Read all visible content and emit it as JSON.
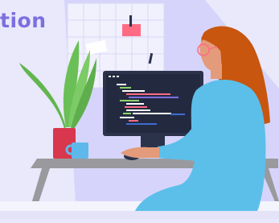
{
  "headline": {
    "text": "tion",
    "color": "#7d6fe0"
  },
  "colors": {
    "background": "#e9e9fb",
    "backdrop": "#d6d4fa",
    "whiteboard": "#f1f0fd",
    "board_line": "#d9d7f8",
    "sticky_note": "#ff6b83",
    "leaves": "#6bbf57",
    "plant_pot": "#d8374e",
    "mug": "#5fb8ea",
    "desk": "#9a9a9e",
    "monitor": "#2b334b",
    "shirt": "#5bbfea",
    "hair": "#c8560f",
    "skin": "#e39b7b",
    "glasses": "#ff6b83"
  },
  "illustration": {
    "items": [
      "whiteboard-icon",
      "sticky-note-icon",
      "plant-icon",
      "mug-icon",
      "desk-icon",
      "monitor-icon",
      "code-lines-icon",
      "mouse-icon",
      "developer-woman-icon"
    ]
  }
}
